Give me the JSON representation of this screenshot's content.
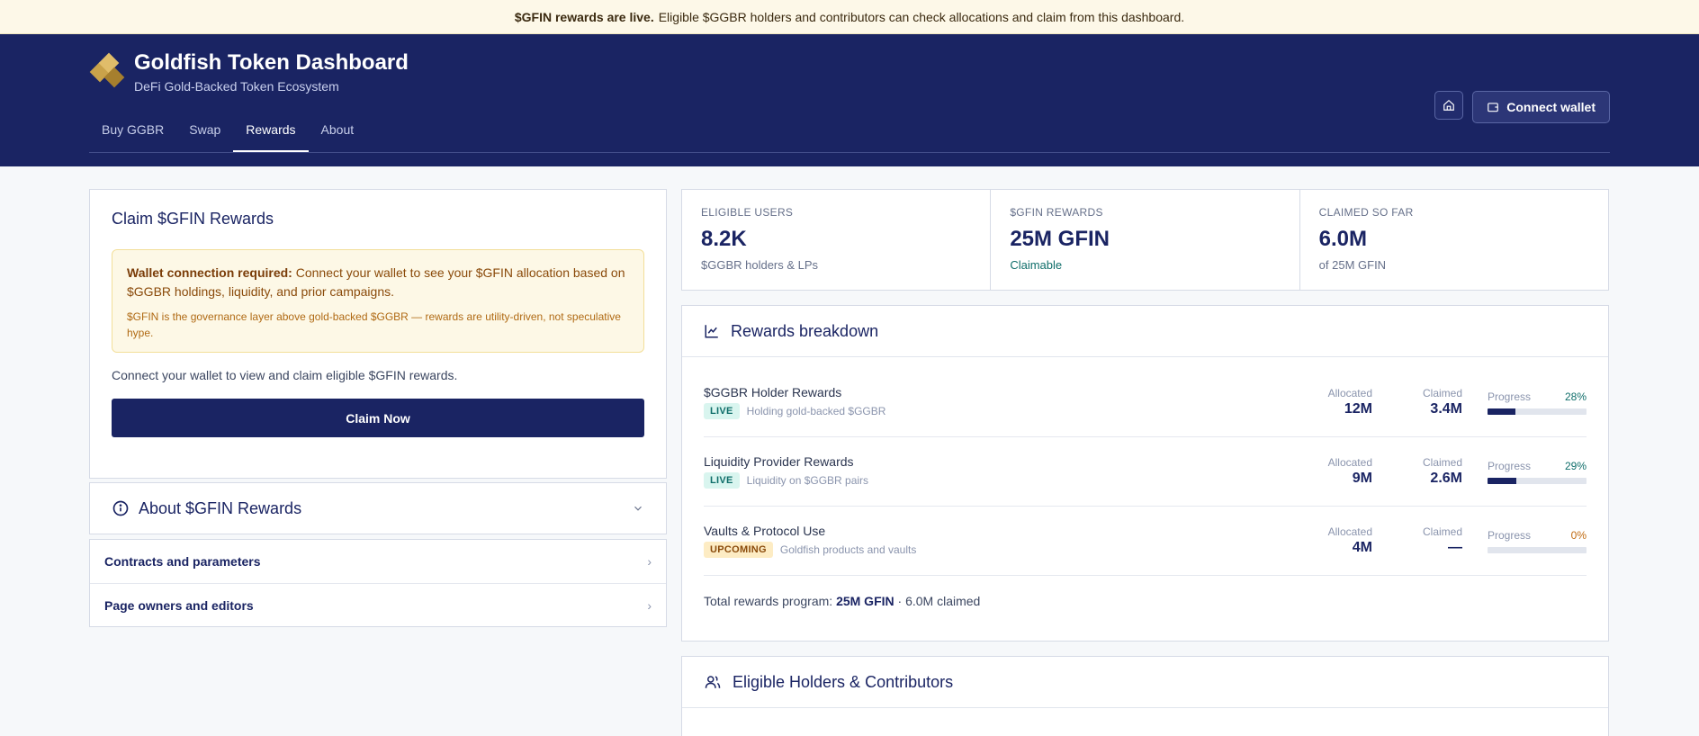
{
  "banner": {
    "strong": "$GFIN rewards are live.",
    "text": "Eligible $GGBR holders and contributors can check allocations and claim from this dashboard."
  },
  "header": {
    "title": "Goldfish Token Dashboard",
    "subtitle": "DeFi Gold-Backed Token Ecosystem",
    "connect_label": "Connect wallet"
  },
  "nav": [
    {
      "label": "Buy GGBR",
      "active": false
    },
    {
      "label": "Swap",
      "active": false
    },
    {
      "label": "Rewards",
      "active": true
    },
    {
      "label": "About",
      "active": false
    }
  ],
  "claim": {
    "title": "Claim $GFIN Rewards",
    "warn_strong": "Wallet connection required:",
    "warn_text": "Connect your wallet to see your $GFIN allocation based on $GGBR holdings, liquidity, and prior campaigns.",
    "warn_note": "$GFIN is the governance layer above gold-backed $GGBR — rewards are utility-driven, not speculative hype.",
    "text": "Connect your wallet to view and claim eligible $GFIN rewards.",
    "button": "Claim Now"
  },
  "about": {
    "title": "About $GFIN Rewards"
  },
  "links": [
    {
      "label": "Contracts and parameters"
    },
    {
      "label": "Page owners and editors"
    }
  ],
  "stats": [
    {
      "label": "ELIGIBLE USERS",
      "value": "8.2K",
      "sub": "$GGBR holders & LPs"
    },
    {
      "label": "$GFIN REWARDS",
      "value": "25M GFIN",
      "sub": "Claimable"
    },
    {
      "label": "CLAIMED SO FAR",
      "value": "6.0M",
      "sub": "of 25M GFIN"
    }
  ],
  "breakdown": {
    "title": "Rewards breakdown",
    "allocated_label": "Allocated",
    "claimed_label": "Claimed",
    "progress_label": "Progress",
    "rows": [
      {
        "name": "$GGBR Holder Rewards",
        "badge": "LIVE",
        "desc": "Holding gold-backed $GGBR",
        "allocated": "12M",
        "claimed": "3.4M",
        "progress": 28,
        "progress_text": "28%"
      },
      {
        "name": "Liquidity Provider Rewards",
        "badge": "LIVE",
        "desc": "Liquidity on $GGBR pairs",
        "allocated": "9M",
        "claimed": "2.6M",
        "progress": 29,
        "progress_text": "29%"
      },
      {
        "name": "Vaults & Protocol Use",
        "badge": "UPCOMING",
        "desc": "Goldfish products and vaults",
        "allocated": "4M",
        "claimed": "—",
        "progress": 0,
        "progress_text": "0%"
      }
    ],
    "total_prefix": "Total rewards program:",
    "total_value": "25M GFIN",
    "total_suffix": "· 6.0M claimed"
  },
  "holders": {
    "title": "Eligible Holders & Contributors"
  },
  "colors": {
    "navy": "#1a2463",
    "gold": "#c9a24a",
    "teal": "#0f6e6a",
    "amber": "#c06a10"
  }
}
